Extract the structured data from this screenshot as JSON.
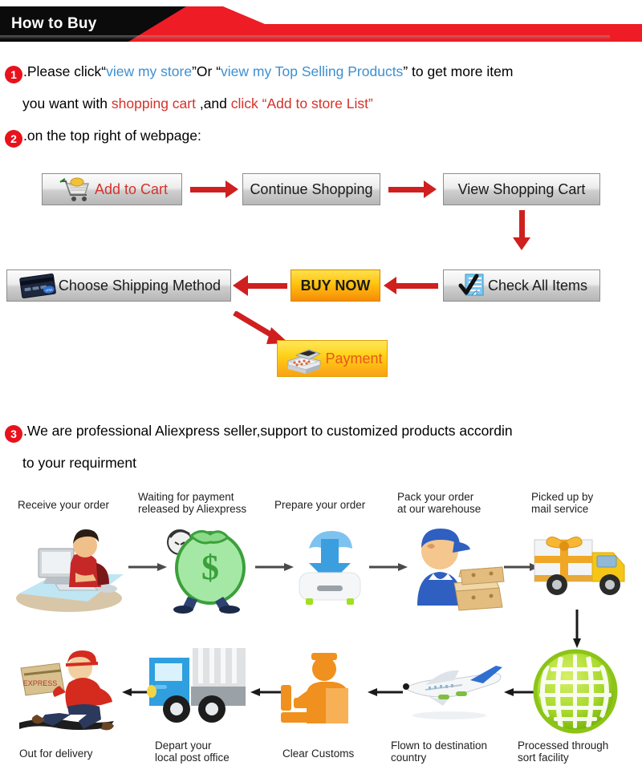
{
  "banner": {
    "title": "How to Buy",
    "red": "#ee1c25",
    "black": "#0b0b0b"
  },
  "steps": [
    {
      "number": "1",
      "segments": [
        {
          "text": ".Please click“",
          "color": "black"
        },
        {
          "text": "view my store",
          "color": "blue"
        },
        {
          "text": "”Or “",
          "color": "black"
        },
        {
          "text": "view my Top Selling Products",
          "color": "blue"
        },
        {
          "text": "” to get more item",
          "color": "black"
        }
      ],
      "line2": [
        {
          "text": "you want with ",
          "color": "black"
        },
        {
          "text": "shopping cart",
          "color": "red"
        },
        {
          "text": " ,and ",
          "color": "black"
        },
        {
          "text": "click “Add to store List”",
          "color": "red"
        }
      ]
    },
    {
      "number": "2",
      "segments": [
        {
          "text": ".on the top right of webpage:",
          "color": "black"
        }
      ]
    },
    {
      "number": "3",
      "segments": [
        {
          "text": ".We are professional Aliexpress seller,support to customized products accordin",
          "color": "black"
        }
      ],
      "line2": [
        {
          "text": "to your requirment",
          "color": "black"
        }
      ]
    }
  ],
  "flow": {
    "add_to_cart": {
      "label": "Add to Cart",
      "icon": "shopping-cart-icon",
      "text_color": "#d6322a"
    },
    "continue_shopping": {
      "label": "Continue Shopping"
    },
    "view_shopping_cart": {
      "label": "View Shopping Cart"
    },
    "check_all_items": {
      "label": "Check All Items",
      "icon": "checklist-icon"
    },
    "buy_now": {
      "label": "BUY NOW",
      "accent": "#fbaa0b"
    },
    "choose_shipping": {
      "label": "Choose Shipping Method",
      "icon": "credit-card-icon"
    },
    "payment": {
      "label": "Payment",
      "icon": "cash-register-icon",
      "text_color": "#e8541e"
    },
    "arrow_color": "#cf1f1f"
  },
  "shipping_steps": {
    "row1": [
      {
        "label": "Receive your order",
        "icon": "person-at-computer-icon"
      },
      {
        "label": "Waiting for payment\nreleased by Aliexpress",
        "icon": "money-bag-icon"
      },
      {
        "label": "Prepare your order",
        "icon": "download-box-icon"
      },
      {
        "label": "Pack your order\nat our warehouse",
        "icon": "warehouse-worker-icon"
      },
      {
        "label": "Picked up by\nmail service",
        "icon": "delivery-truck-gift-icon"
      }
    ],
    "row2": [
      {
        "label": "Out for delivery",
        "icon": "running-courier-icon"
      },
      {
        "label": "Depart your\nlocal post office",
        "icon": "blue-truck-icon"
      },
      {
        "label": "Clear Customs",
        "icon": "customs-officer-icon"
      },
      {
        "label": "Flown to destination\ncountry",
        "icon": "airplane-icon"
      },
      {
        "label": "Processed through\nsort facility",
        "icon": "green-globe-icon"
      }
    ],
    "connector_color": "#4a4a4a"
  }
}
